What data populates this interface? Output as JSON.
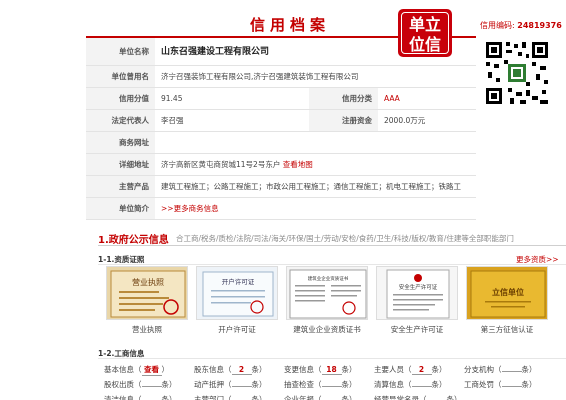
{
  "header": {
    "title": "信用档案",
    "stamp": [
      "单立",
      "位信"
    ],
    "credit_no_label": "信用编码:",
    "credit_no": "24819376"
  },
  "info": {
    "name_label": "单位名称",
    "name": "山东召强建设工程有限公司",
    "former_label": "单位曾用名",
    "former": "济宁召强装饰工程有限公司,济宁召强建筑装饰工程有限公司",
    "score_label": "信用分值",
    "score": "91.45",
    "class_label": "信用分类",
    "class": "AAA",
    "rep_label": "法定代表人",
    "rep": "李召强",
    "capital_label": "注册资金",
    "capital": "2000.0万元",
    "web_label": "商务网址",
    "web": "",
    "addr_label": "详细地址",
    "addr": "济宁高新区黄屯商贸城11号2号东户",
    "map_link": "查看地图",
    "biz_label": "主营产品",
    "biz": "建筑工程施工；公路工程施工；市政公用工程施工；通信工程施工；机电工程施工；铁路工",
    "intro_label": "单位简介",
    "intro_link": ">>更多商务信息"
  },
  "section1": {
    "title": "1.政府公示信息",
    "tabs": "合工商/税务/质检/法院/司法/海关/环保/国土/劳动/安检/食药/卫生/科技/版权/教育/住建等全部职能部门"
  },
  "qualifications": {
    "title": "1-1.资质证照",
    "more": "更多资质>>",
    "items": [
      {
        "caption": "营业执照",
        "thumb_text": "营业执照"
      },
      {
        "caption": "开户许可证",
        "thumb_text": "开户许可证"
      },
      {
        "caption": "建筑业企业资质证书",
        "thumb_text": "建筑业企业资质证书"
      },
      {
        "caption": "安全生产许可证",
        "thumb_text": "安全生产许可证"
      },
      {
        "caption": "第三方征信认证",
        "thumb_text": "立信单位"
      }
    ]
  },
  "business": {
    "title": "1-2.工商信息",
    "items": [
      {
        "label": "基本信息",
        "count": "查看",
        "unit": ""
      },
      {
        "label": "股东信息",
        "count": "2",
        "unit": "条"
      },
      {
        "label": "变更信息",
        "count": "18",
        "unit": "条"
      },
      {
        "label": "主要人员",
        "count": "2",
        "unit": "条"
      },
      {
        "label": "分支机构",
        "count": "",
        "unit": "条"
      },
      {
        "label": "股权出质",
        "count": "",
        "unit": "条"
      },
      {
        "label": "动产抵押",
        "count": "",
        "unit": "条"
      },
      {
        "label": "抽查检查",
        "count": "",
        "unit": "条"
      },
      {
        "label": "清算信息",
        "count": "",
        "unit": "条"
      },
      {
        "label": "工商处罚",
        "count": "",
        "unit": "条"
      },
      {
        "label": "清洁信息",
        "count": "",
        "unit": "条"
      },
      {
        "label": "主营部门",
        "count": "",
        "unit": "条"
      },
      {
        "label": "企业年报",
        "count": "",
        "unit": "条"
      },
      {
        "label": "经营异常名录",
        "count": "",
        "unit": "条"
      }
    ]
  },
  "colors": {
    "accent": "#c40000",
    "stamp": "#c8000a",
    "label_bg": "#f3f3f3"
  }
}
